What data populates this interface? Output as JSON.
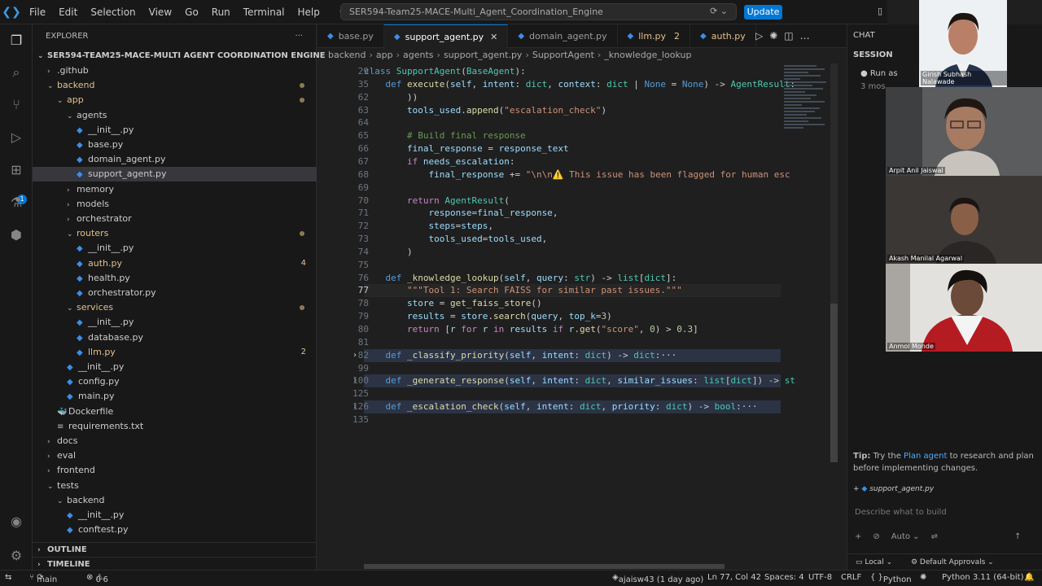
{
  "menu": [
    "File",
    "Edit",
    "Selection",
    "View",
    "Go",
    "Run",
    "Terminal",
    "Help"
  ],
  "command_center": "SER594-Team25-MACE-Multi_Agent_Coordination_Engine",
  "update_label": "Update",
  "explorer": {
    "title": "EXPLORER",
    "more": "···",
    "root": "SER594-TEAM25-MACE-MULTI AGENT COORDINATION ENGINE",
    "items": [
      {
        "label": ".github",
        "indent": 1,
        "type": "folder",
        "open": false
      },
      {
        "label": "backend",
        "indent": 1,
        "type": "folder",
        "open": true,
        "mod": true
      },
      {
        "label": "app",
        "indent": 2,
        "type": "folder",
        "open": true,
        "mod": true
      },
      {
        "label": "agents",
        "indent": 3,
        "type": "folder",
        "open": true
      },
      {
        "label": "__init__.py",
        "indent": 4,
        "type": "py"
      },
      {
        "label": "base.py",
        "indent": 4,
        "type": "py"
      },
      {
        "label": "domain_agent.py",
        "indent": 4,
        "type": "py"
      },
      {
        "label": "support_agent.py",
        "indent": 4,
        "type": "py",
        "selected": true
      },
      {
        "label": "memory",
        "indent": 3,
        "type": "folder",
        "open": false
      },
      {
        "label": "models",
        "indent": 3,
        "type": "folder",
        "open": false
      },
      {
        "label": "orchestrator",
        "indent": 3,
        "type": "folder",
        "open": false
      },
      {
        "label": "routers",
        "indent": 3,
        "type": "folder",
        "open": true,
        "mod": true
      },
      {
        "label": "__init__.py",
        "indent": 4,
        "type": "py"
      },
      {
        "label": "auth.py",
        "indent": 4,
        "type": "py",
        "badge": "4"
      },
      {
        "label": "health.py",
        "indent": 4,
        "type": "py"
      },
      {
        "label": "orchestrator.py",
        "indent": 4,
        "type": "py"
      },
      {
        "label": "services",
        "indent": 3,
        "type": "folder",
        "open": true,
        "mod": true
      },
      {
        "label": "__init__.py",
        "indent": 4,
        "type": "py"
      },
      {
        "label": "database.py",
        "indent": 4,
        "type": "py"
      },
      {
        "label": "llm.py",
        "indent": 4,
        "type": "py",
        "badge": "2"
      },
      {
        "label": "__init__.py",
        "indent": 3,
        "type": "py"
      },
      {
        "label": "config.py",
        "indent": 3,
        "type": "py"
      },
      {
        "label": "main.py",
        "indent": 3,
        "type": "py"
      },
      {
        "label": "Dockerfile",
        "indent": 2,
        "type": "docker"
      },
      {
        "label": "requirements.txt",
        "indent": 2,
        "type": "txt"
      },
      {
        "label": "docs",
        "indent": 1,
        "type": "folder",
        "open": false
      },
      {
        "label": "eval",
        "indent": 1,
        "type": "folder",
        "open": false
      },
      {
        "label": "frontend",
        "indent": 1,
        "type": "folder",
        "open": false
      },
      {
        "label": "tests",
        "indent": 1,
        "type": "folder",
        "open": true
      },
      {
        "label": "backend",
        "indent": 2,
        "type": "folder",
        "open": true
      },
      {
        "label": "__init__.py",
        "indent": 3,
        "type": "py"
      },
      {
        "label": "conftest.py",
        "indent": 3,
        "type": "py"
      }
    ],
    "outline": "OUTLINE",
    "timeline": "TIMELINE"
  },
  "tabs": [
    {
      "label": "base.py"
    },
    {
      "label": "support_agent.py",
      "active": true
    },
    {
      "label": "domain_agent.py"
    },
    {
      "label": "llm.py",
      "count": "2",
      "yellow": true
    },
    {
      "label": "auth.py",
      "yellow": true
    }
  ],
  "breadcrumb": [
    "backend",
    "app",
    "agents",
    "support_agent.py",
    "SupportAgent",
    "_knowledge_lookup"
  ],
  "code": [
    {
      "n": "29",
      "html": "<span class='kb'>class</span> <span class='cl'>SupportAgent</span>(<span class='cl'>BaseAgent</span>):"
    },
    {
      "n": "35",
      "html": "    <span class='kb'>def</span> <span class='fn'>execute</span>(<span class='pa'>self</span>, <span class='pa'>intent</span>: <span class='cl'>dict</span>, <span class='pa'>context</span>: <span class='cl'>dict</span> | <span class='kb'>None</span> = <span class='kb'>None</span>) -> <span class='cl'>AgentResult</span>:"
    },
    {
      "n": "62",
      "html": "        ))"
    },
    {
      "n": "63",
      "html": "        <span class='pa'>tools_used</span>.<span class='fn'>append</span>(<span class='st'>\"escalation_check\"</span>)"
    },
    {
      "n": "64",
      "html": ""
    },
    {
      "n": "65",
      "html": "        <span class='cm'># Build final response</span>"
    },
    {
      "n": "66",
      "html": "        <span class='pa'>final_response</span> = <span class='pa'>response_text</span>"
    },
    {
      "n": "67",
      "html": "        <span class='kw'>if</span> <span class='pa'>needs_escalation</span>:"
    },
    {
      "n": "68",
      "html": "            <span class='pa'>final_response</span> += <span class='st'>\"\\n\\n⚠️ This issue has been flagged for human esc</span>"
    },
    {
      "n": "69",
      "html": ""
    },
    {
      "n": "70",
      "html": "        <span class='kw'>return</span> <span class='cl'>AgentResult</span>("
    },
    {
      "n": "71",
      "html": "            <span class='pa'>response</span>=<span class='pa'>final_response</span>,"
    },
    {
      "n": "72",
      "html": "            <span class='pa'>steps</span>=<span class='pa'>steps</span>,"
    },
    {
      "n": "73",
      "html": "            <span class='pa'>tools_used</span>=<span class='pa'>tools_used</span>,"
    },
    {
      "n": "74",
      "html": "        )"
    },
    {
      "n": "75",
      "html": ""
    },
    {
      "n": "76",
      "html": "    <span class='kb'>def</span> <span class='fn'>_knowledge_lookup</span>(<span class='pa'>self</span>, <span class='pa'>query</span>: <span class='cl'>str</span>) -> <span class='cl'>list</span>[<span class='cl'>dict</span>]:"
    },
    {
      "n": "77",
      "html": "        <span class='st'>\"\"\"Tool 1: Search FAISS for similar past issues.\"\"\"</span>",
      "cur": true
    },
    {
      "n": "78",
      "html": "        <span class='pa'>store</span> = <span class='fn'>get_faiss_store</span>()"
    },
    {
      "n": "79",
      "html": "        <span class='pa'>results</span> = <span class='pa'>store</span>.<span class='fn'>search</span>(<span class='pa'>query</span>, <span class='pa'>top_k</span>=<span class='nu'>3</span>)"
    },
    {
      "n": "80",
      "html": "        <span class='kw'>return</span> [<span class='pa'>r</span> <span class='kw'>for</span> <span class='pa'>r</span> <span class='kw'>in</span> <span class='pa'>results</span> <span class='kw'>if</span> <span class='pa'>r</span>.<span class='fn'>get</span>(<span class='st'>\"score\"</span>, <span class='nu'>0</span>) > <span class='nu'>0.3</span>]"
    },
    {
      "n": "81",
      "html": ""
    },
    {
      "n": "82",
      "html": "    <span class='kb'>def</span> <span class='fn'>_classify_priority</span>(<span class='pa'>self</span>, <span class='pa'>intent</span>: <span class='cl'>dict</span>) -> <span class='cl'>dict</span>:···",
      "fold": true
    },
    {
      "n": "99",
      "html": ""
    },
    {
      "n": "100",
      "html": "    <span class='kb'>def</span> <span class='fn'>_generate_response</span>(<span class='pa'>self</span>, <span class='pa'>intent</span>: <span class='cl'>dict</span>, <span class='pa'>similar_issues</span>: <span class='cl'>list</span>[<span class='cl'>dict</span>]) -> <span class='cl'>st</span>",
      "fold": true
    },
    {
      "n": "125",
      "html": ""
    },
    {
      "n": "126",
      "html": "    <span class='kb'>def</span> <span class='fn'>_escalation_check</span>(<span class='pa'>self</span>, <span class='pa'>intent</span>: <span class='cl'>dict</span>, <span class='pa'>priority</span>: <span class='cl'>dict</span>) -> <span class='cl'>bool</span>:···",
      "fold": true
    },
    {
      "n": "135",
      "html": ""
    }
  ],
  "chat": {
    "tab": "CHAT",
    "session": "SESSION",
    "run_as": "Run as",
    "ago": "3 mos",
    "tip_prefix": "Tip:",
    "tip_a": "Try the",
    "tip_link": "Plan agent",
    "tip_b": "to research and plan before implementing changes.",
    "context_file": "support_agent.py",
    "placeholder": "Describe what to build",
    "mode": "Auto",
    "location": "Local",
    "approvals": "Default Approvals"
  },
  "video": [
    {
      "name": "Girish Subhash Nalawade"
    },
    {
      "name": "Arpit Anil Jaiswal"
    },
    {
      "name": "Akash Manilal Agarwal"
    },
    {
      "name": "Anmol Monde"
    }
  ],
  "status": {
    "branch": "main",
    "errors": "0",
    "warnings": "6",
    "blame": "ajaisw43 (1 day ago)",
    "position": "Ln 77, Col 42",
    "spaces": "Spaces: 4",
    "encoding": "UTF-8",
    "eol": "CRLF",
    "language": "Python",
    "interpreter": "Python 3.11 (64-bit)"
  }
}
